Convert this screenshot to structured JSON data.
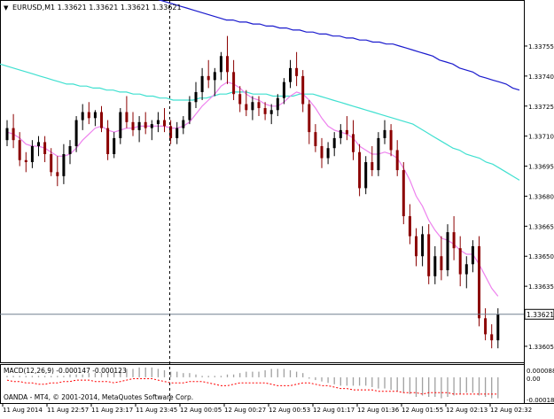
{
  "header": {
    "arrow_glyph": "▼",
    "label": "EURUSD,M1  1.33621 1.33621 1.33621 1.33621"
  },
  "price_axis": {
    "ticks": [
      "1.33755",
      "1.33740",
      "1.33725",
      "1.33710",
      "1.33695",
      "1.33680",
      "1.33665",
      "1.33650",
      "1.33635",
      "1.33605"
    ],
    "current_price_label": "1.33621"
  },
  "macd_panel": {
    "label": "MACD(12,26,9) -0.000147 -0.000123",
    "axis_labels": [
      "0.000088",
      "0.00",
      "-0.000184"
    ]
  },
  "watermark": "OANDA - MT4, © 2001-2014, MetaQuotes Software Corp.",
  "time_axis": {
    "labels": [
      "11 Aug 2014",
      "11 Aug 22:57",
      "11 Aug 23:17",
      "11 Aug 23:45",
      "12 Aug 00:05",
      "12 Aug 00:27",
      "12 Aug 00:53",
      "12 Aug 01:17",
      "12 Aug 01:36",
      "12 Aug 01:55",
      "12 Aug 02:13",
      "12 Aug 02:32"
    ]
  },
  "colors": {
    "bull": "#000000",
    "bear": "#8b0000",
    "ma_fast": "#ee82ee",
    "ma_mid": "#40e0d0",
    "ma_slow": "#1a1acd",
    "price_line": "#708090",
    "macd_hist": "#a0a0a0",
    "macd_signal": "#ff0000",
    "grid": "#000000"
  },
  "chart_data": {
    "type": "candlestick",
    "symbol": "EURUSD",
    "timeframe": "M1",
    "ylim": [
      1.33597,
      1.33778
    ],
    "current_price": 1.33621,
    "candles": [
      [
        1.33708,
        1.33718,
        1.33705,
        1.33714
      ],
      [
        1.33714,
        1.33721,
        1.33704,
        1.33708
      ],
      [
        1.33708,
        1.33712,
        1.33695,
        1.33698
      ],
      [
        1.33698,
        1.33702,
        1.33692,
        1.33697
      ],
      [
        1.33697,
        1.33708,
        1.33694,
        1.33705
      ],
      [
        1.33705,
        1.3371,
        1.337,
        1.33707
      ],
      [
        1.33707,
        1.3371,
        1.33697,
        1.33701
      ],
      [
        1.33701,
        1.33704,
        1.3369,
        1.33692
      ],
      [
        1.33692,
        1.337,
        1.33685,
        1.3369
      ],
      [
        1.3369,
        1.33706,
        1.33686,
        1.33701
      ],
      [
        1.33701,
        1.33708,
        1.33696,
        1.33705
      ],
      [
        1.33705,
        1.3372,
        1.33702,
        1.33718
      ],
      [
        1.33718,
        1.33726,
        1.33713,
        1.33722
      ],
      [
        1.33722,
        1.33727,
        1.33716,
        1.33719
      ],
      [
        1.33719,
        1.33723,
        1.33715,
        1.33722
      ],
      [
        1.33722,
        1.33725,
        1.33712,
        1.33714
      ],
      [
        1.33714,
        1.33718,
        1.33698,
        1.33701
      ],
      [
        1.33701,
        1.33712,
        1.33699,
        1.33709
      ],
      [
        1.33709,
        1.33724,
        1.33706,
        1.33722
      ],
      [
        1.33722,
        1.3373,
        1.33714,
        1.33717
      ],
      [
        1.33717,
        1.33722,
        1.3371,
        1.33713
      ],
      [
        1.33713,
        1.3372,
        1.33707,
        1.33717
      ],
      [
        1.33717,
        1.33722,
        1.33711,
        1.33714
      ],
      [
        1.33714,
        1.33718,
        1.33708,
        1.33716
      ],
      [
        1.33716,
        1.33722,
        1.33712,
        1.33718
      ],
      [
        1.33718,
        1.33724,
        1.33712,
        1.33715
      ],
      [
        1.33715,
        1.33718,
        1.33706,
        1.33709
      ],
      [
        1.33709,
        1.33717,
        1.33706,
        1.33714
      ],
      [
        1.33714,
        1.3372,
        1.33711,
        1.33718
      ],
      [
        1.33718,
        1.3373,
        1.33716,
        1.33727
      ],
      [
        1.33727,
        1.33737,
        1.33724,
        1.33732
      ],
      [
        1.33732,
        1.33744,
        1.33728,
        1.3374
      ],
      [
        1.3374,
        1.33748,
        1.33734,
        1.33738
      ],
      [
        1.33738,
        1.33744,
        1.3373,
        1.33742
      ],
      [
        1.33742,
        1.33752,
        1.33738,
        1.3375
      ],
      [
        1.3375,
        1.3376,
        1.33736,
        1.33742
      ],
      [
        1.33742,
        1.33748,
        1.33728,
        1.33731
      ],
      [
        1.33731,
        1.33735,
        1.33722,
        1.33726
      ],
      [
        1.33726,
        1.33733,
        1.3372,
        1.33723
      ],
      [
        1.33723,
        1.3373,
        1.33718,
        1.33727
      ],
      [
        1.33727,
        1.3373,
        1.3372,
        1.33724
      ],
      [
        1.33724,
        1.33727,
        1.33718,
        1.33721
      ],
      [
        1.33721,
        1.33726,
        1.33716,
        1.33723
      ],
      [
        1.33723,
        1.33731,
        1.3372,
        1.33729
      ],
      [
        1.33729,
        1.33739,
        1.33726,
        1.33737
      ],
      [
        1.33737,
        1.33748,
        1.33734,
        1.33744
      ],
      [
        1.33744,
        1.33752,
        1.33735,
        1.3374
      ],
      [
        1.3374,
        1.33743,
        1.33722,
        1.33726
      ],
      [
        1.33726,
        1.33728,
        1.33706,
        1.33712
      ],
      [
        1.33712,
        1.33716,
        1.33702,
        1.33705
      ],
      [
        1.33705,
        1.33709,
        1.33694,
        1.33699
      ],
      [
        1.33699,
        1.33707,
        1.33696,
        1.33704
      ],
      [
        1.33704,
        1.33712,
        1.337,
        1.33709
      ],
      [
        1.33709,
        1.33716,
        1.33706,
        1.33713
      ],
      [
        1.33713,
        1.3372,
        1.33708,
        1.33711
      ],
      [
        1.33711,
        1.33718,
        1.33698,
        1.33702
      ],
      [
        1.33702,
        1.33706,
        1.3368,
        1.33684
      ],
      [
        1.33684,
        1.337,
        1.33681,
        1.33697
      ],
      [
        1.33697,
        1.33705,
        1.3369,
        1.33693
      ],
      [
        1.33693,
        1.33712,
        1.3369,
        1.33709
      ],
      [
        1.33709,
        1.33718,
        1.33706,
        1.33713
      ],
      [
        1.33713,
        1.33716,
        1.337,
        1.33703
      ],
      [
        1.33703,
        1.33708,
        1.3369,
        1.33693
      ],
      [
        1.33693,
        1.33697,
        1.33666,
        1.3367
      ],
      [
        1.3367,
        1.33676,
        1.33656,
        1.3366
      ],
      [
        1.3366,
        1.33664,
        1.33645,
        1.3365
      ],
      [
        1.3365,
        1.33665,
        1.33645,
        1.33661
      ],
      [
        1.33661,
        1.33666,
        1.33636,
        1.3364
      ],
      [
        1.3364,
        1.33655,
        1.33636,
        1.3365
      ],
      [
        1.3365,
        1.3366,
        1.33638,
        1.33643
      ],
      [
        1.33643,
        1.33666,
        1.3364,
        1.33662
      ],
      [
        1.33662,
        1.3367,
        1.33648,
        1.33654
      ],
      [
        1.33654,
        1.3366,
        1.33635,
        1.33641
      ],
      [
        1.33641,
        1.3365,
        1.33634,
        1.33646
      ],
      [
        1.33646,
        1.33658,
        1.33642,
        1.33655
      ],
      [
        1.33655,
        1.3366,
        1.33615,
        1.33619
      ],
      [
        1.33619,
        1.33624,
        1.33608,
        1.33611
      ],
      [
        1.33611,
        1.33616,
        1.33604,
        1.33608
      ],
      [
        1.33608,
        1.33624,
        1.33604,
        1.33621
      ]
    ],
    "ma_fast": [
      1.33712,
      1.33711,
      1.33709,
      1.33706,
      1.33705,
      1.33705,
      1.33704,
      1.33702,
      1.337,
      1.337,
      1.33701,
      1.33704,
      1.33708,
      1.33711,
      1.33714,
      1.33715,
      1.33713,
      1.33712,
      1.33713,
      1.33714,
      1.33714,
      1.33715,
      1.33715,
      1.33715,
      1.33715,
      1.33715,
      1.33714,
      1.33714,
      1.33715,
      1.33717,
      1.33721,
      1.33725,
      1.33728,
      1.33731,
      1.33735,
      1.33737,
      1.33736,
      1.33734,
      1.33731,
      1.33729,
      1.33728,
      1.33726,
      1.33725,
      1.33725,
      1.33727,
      1.3373,
      1.33732,
      1.33731,
      1.33728,
      1.33724,
      1.33719,
      1.33715,
      1.33713,
      1.33712,
      1.33711,
      1.33709,
      1.33705,
      1.33703,
      1.33701,
      1.33701,
      1.33702,
      1.33701,
      1.33699,
      1.33694,
      1.33688,
      1.3368,
      1.33675,
      1.33668,
      1.33663,
      1.33659,
      1.33658,
      1.33656,
      1.33653,
      1.33651,
      1.33651,
      1.33646,
      1.3364,
      1.33634,
      1.3363
    ],
    "ma_mid": [
      1.33746,
      1.33745,
      1.33744,
      1.33743,
      1.33742,
      1.33741,
      1.3374,
      1.33739,
      1.33738,
      1.33737,
      1.33736,
      1.33736,
      1.33735,
      1.33735,
      1.33734,
      1.33734,
      1.33733,
      1.33733,
      1.33732,
      1.33732,
      1.33731,
      1.33731,
      1.3373,
      1.3373,
      1.33729,
      1.33729,
      1.33728,
      1.33728,
      1.33728,
      1.33728,
      1.33729,
      1.33729,
      1.3373,
      1.33731,
      1.33731,
      1.33732,
      1.33732,
      1.33732,
      1.33731,
      1.33731,
      1.33731,
      1.3373,
      1.3373,
      1.3373,
      1.3373,
      1.33731,
      1.33731,
      1.33731,
      1.3373,
      1.33729,
      1.33728,
      1.33727,
      1.33726,
      1.33725,
      1.33724,
      1.33723,
      1.33722,
      1.33721,
      1.3372,
      1.33719,
      1.33718,
      1.33717,
      1.33716,
      1.33714,
      1.33712,
      1.3371,
      1.33708,
      1.33706,
      1.33704,
      1.33703,
      1.33701,
      1.337,
      1.33699,
      1.33697,
      1.33696,
      1.33694,
      1.33692,
      1.3369,
      1.33688
    ],
    "ma_slow": [
      1.33802,
      1.33801,
      1.338,
      1.33799,
      1.33798,
      1.33797,
      1.33796,
      1.33795,
      1.33794,
      1.33793,
      1.33792,
      1.33791,
      1.3379,
      1.33789,
      1.33788,
      1.33787,
      1.33786,
      1.33785,
      1.33784,
      1.33783,
      1.33782,
      1.33781,
      1.3378,
      1.33779,
      1.33778,
      1.33777,
      1.33776,
      1.33775,
      1.33774,
      1.33773,
      1.33772,
      1.33771,
      1.3377,
      1.33769,
      1.33768,
      1.33768,
      1.33767,
      1.33767,
      1.33766,
      1.33766,
      1.33765,
      1.33765,
      1.33764,
      1.33764,
      1.33763,
      1.33763,
      1.33762,
      1.33762,
      1.33761,
      1.33761,
      1.3376,
      1.3376,
      1.33759,
      1.33759,
      1.33758,
      1.33758,
      1.33757,
      1.33757,
      1.33756,
      1.33756,
      1.33755,
      1.33754,
      1.33753,
      1.33752,
      1.33751,
      1.3375,
      1.33748,
      1.33747,
      1.33746,
      1.33744,
      1.33743,
      1.33742,
      1.3374,
      1.33739,
      1.33738,
      1.33737,
      1.33736,
      1.33734,
      1.33733
    ],
    "macd": {
      "ylim": [
        -0.000184,
        8.8e-05
      ],
      "histogram": [
        1e-05,
        1e-05,
        1e-05,
        1e-05,
        1e-05,
        1e-05,
        1e-05,
        1e-05,
        1e-05,
        1e-05,
        2e-05,
        2e-05,
        2e-05,
        3e-05,
        3e-05,
        3e-05,
        3e-05,
        4e-05,
        5e-05,
        6e-05,
        6e-05,
        7e-05,
        7e-05,
        7e-05,
        6e-05,
        5e-05,
        4e-05,
        4e-05,
        3e-05,
        3e-05,
        2e-05,
        1e-05,
        1e-05,
        1e-05,
        1e-05,
        2e-05,
        2e-05,
        3e-05,
        4e-05,
        4e-05,
        4e-05,
        5e-05,
        6e-05,
        6e-05,
        6e-05,
        5e-05,
        4e-05,
        3e-05,
        -1e-05,
        -2e-05,
        -3e-05,
        -4e-05,
        -5e-05,
        -6e-05,
        -6e-05,
        -6e-05,
        -6e-05,
        -6e-05,
        -7e-05,
        -8e-05,
        -8e-05,
        -9e-05,
        -0.0001,
        -0.00011,
        -0.00012,
        -0.00014,
        -0.00013,
        -0.00014,
        -0.00014,
        -0.00015,
        -0.00014,
        -0.00013,
        -0.00012,
        -0.00011,
        -0.00011,
        -0.00013,
        -0.00014,
        -0.00015,
        -0.00015
      ],
      "signal": [
        -2e-05,
        -3e-05,
        -3e-05,
        -4e-05,
        -4e-05,
        -5e-05,
        -5e-05,
        -4e-05,
        -4e-05,
        -3e-05,
        -3e-05,
        -2e-05,
        -2e-05,
        -2e-05,
        -3e-05,
        -3e-05,
        -3e-05,
        -4e-05,
        -3e-05,
        -2e-05,
        -1e-05,
        -1e-05,
        -1e-05,
        -1e-05,
        -2e-05,
        -3e-05,
        -4e-05,
        -4e-05,
        -4e-05,
        -3e-05,
        -3e-05,
        -3e-05,
        -4e-05,
        -5e-05,
        -6e-05,
        -6e-05,
        -5e-05,
        -4e-05,
        -4e-05,
        -4e-05,
        -4e-05,
        -4e-05,
        -5e-05,
        -6e-05,
        -6e-05,
        -6e-05,
        -5e-05,
        -4e-05,
        -4e-05,
        -5e-05,
        -6e-05,
        -6e-05,
        -7e-05,
        -8e-05,
        -8e-05,
        -9e-05,
        -9e-05,
        -9e-05,
        -9e-05,
        -0.0001,
        -0.0001,
        -0.0001,
        -0.0001,
        -0.00011,
        -0.00011,
        -0.00011,
        -0.00012,
        -0.00011,
        -0.00011,
        -0.00011,
        -0.00011,
        -0.00012,
        -0.00012,
        -0.00012,
        -0.00012,
        -0.00012,
        -0.00012,
        -0.00012,
        -0.00012
      ]
    },
    "cursor_time": "11 Aug 23:45",
    "legend": "none",
    "grid": false
  }
}
